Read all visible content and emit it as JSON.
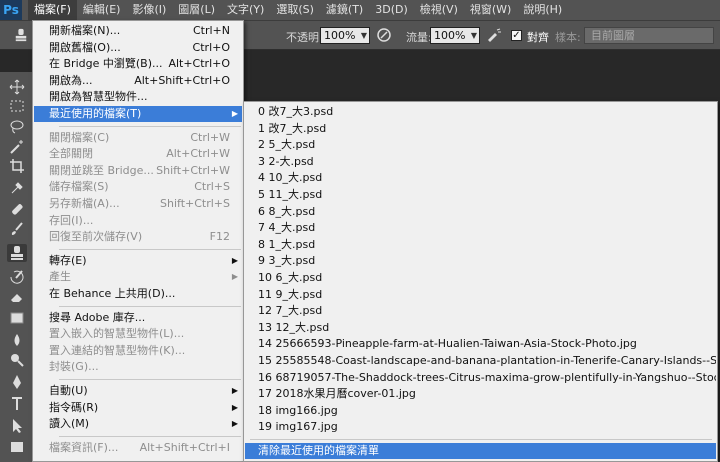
{
  "app": {
    "logo": "Ps"
  },
  "menubar": {
    "items": [
      {
        "label": "檔案(F)",
        "active": true
      },
      {
        "label": "編輯(E)"
      },
      {
        "label": "影像(I)"
      },
      {
        "label": "圖層(L)"
      },
      {
        "label": "文字(Y)"
      },
      {
        "label": "選取(S)"
      },
      {
        "label": "濾鏡(T)"
      },
      {
        "label": "3D(D)"
      },
      {
        "label": "檢視(V)"
      },
      {
        "label": "視窗(W)"
      },
      {
        "label": "說明(H)"
      }
    ]
  },
  "options": {
    "opacity_label": "不透明:",
    "opacity_value": "100%",
    "flow_label": "流量:",
    "flow_value": "100%",
    "align_label": "對齊",
    "sample_label": "樣本:",
    "sample_value": "目前圖層"
  },
  "toolbar": {
    "icons": [
      "move-icon",
      "marquee-icon",
      "lasso-icon",
      "magic-wand-icon",
      "crop-icon",
      "eyedropper-icon",
      "healing-brush-icon",
      "brush-icon",
      "clone-stamp-icon",
      "history-brush-icon",
      "eraser-icon",
      "gradient-icon",
      "blur-icon",
      "dodge-icon",
      "pen-icon",
      "type-icon",
      "path-select-icon",
      "shape-icon"
    ]
  },
  "file_menu": {
    "items": [
      {
        "label": "開新檔案(N)...",
        "shortcut": "Ctrl+N"
      },
      {
        "label": "開啟舊檔(O)...",
        "shortcut": "Ctrl+O"
      },
      {
        "label": "在 Bridge 中瀏覽(B)...",
        "shortcut": "Alt+Ctrl+O"
      },
      {
        "label": "開啟為...",
        "shortcut": "Alt+Shift+Ctrl+O"
      },
      {
        "label": "開啟為智慧型物件..."
      },
      {
        "label": "最近使用的檔案(T)",
        "submenu": true,
        "highlighted": true
      },
      {
        "separator": true
      },
      {
        "label": "關閉檔案(C)",
        "shortcut": "Ctrl+W",
        "disabled": true
      },
      {
        "label": "全部關閉",
        "shortcut": "Alt+Ctrl+W",
        "disabled": true
      },
      {
        "label": "關閉並跳至 Bridge...",
        "shortcut": "Shift+Ctrl+W",
        "disabled": true
      },
      {
        "label": "儲存檔案(S)",
        "shortcut": "Ctrl+S",
        "disabled": true
      },
      {
        "label": "另存新檔(A)...",
        "shortcut": "Shift+Ctrl+S",
        "disabled": true
      },
      {
        "label": "存回(I)...",
        "disabled": true
      },
      {
        "label": "回復至前次儲存(V)",
        "shortcut": "F12",
        "disabled": true
      },
      {
        "separator": true
      },
      {
        "label": "轉存(E)",
        "submenu": true
      },
      {
        "label": "產生",
        "submenu": true,
        "disabled": true
      },
      {
        "label": "在 Behance 上共用(D)..."
      },
      {
        "separator": true
      },
      {
        "label": "搜尋 Adobe 庫存..."
      },
      {
        "label": "置入嵌入的智慧型物件(L)...",
        "disabled": true
      },
      {
        "label": "置入連結的智慧型物件(K)...",
        "disabled": true
      },
      {
        "label": "封裝(G)...",
        "disabled": true
      },
      {
        "separator": true
      },
      {
        "label": "自動(U)",
        "submenu": true
      },
      {
        "label": "指令碼(R)",
        "submenu": true
      },
      {
        "label": "讀入(M)",
        "submenu": true
      },
      {
        "separator": true
      },
      {
        "label": "檔案資訊(F)...",
        "shortcut": "Alt+Shift+Ctrl+I",
        "disabled": true
      }
    ]
  },
  "recent_menu": {
    "files": [
      "0  改7_大3.psd",
      "1  改7_大.psd",
      "2  5_大.psd",
      "3  2-大.psd",
      "4  10_大.psd",
      "5  11_大.psd",
      "6  8_大.psd",
      "7  4_大.psd",
      "8  1_大.psd",
      "9  3_大.psd",
      "10  6_大.psd",
      "11  9_大.psd",
      "12  7_大.psd",
      "13  12_大.psd",
      "14  25666593-Pineapple-farm-at-Hualien-Taiwan-Asia-Stock-Photo.jpg",
      "15  25585548-Coast-landscape-and-banana-plantation-in-Tenerife-Canary-Islands--Stock...",
      "16  68719057-The-Shaddock-trees-Citrus-maxima-grow-plentifully-in-Yangshuo--Stock-P...",
      "17  2018水果月曆cover-01.jpg",
      "18  img166.jpg",
      "19  img167.jpg"
    ],
    "clear_label": "清除最近使用的檔案清單"
  }
}
